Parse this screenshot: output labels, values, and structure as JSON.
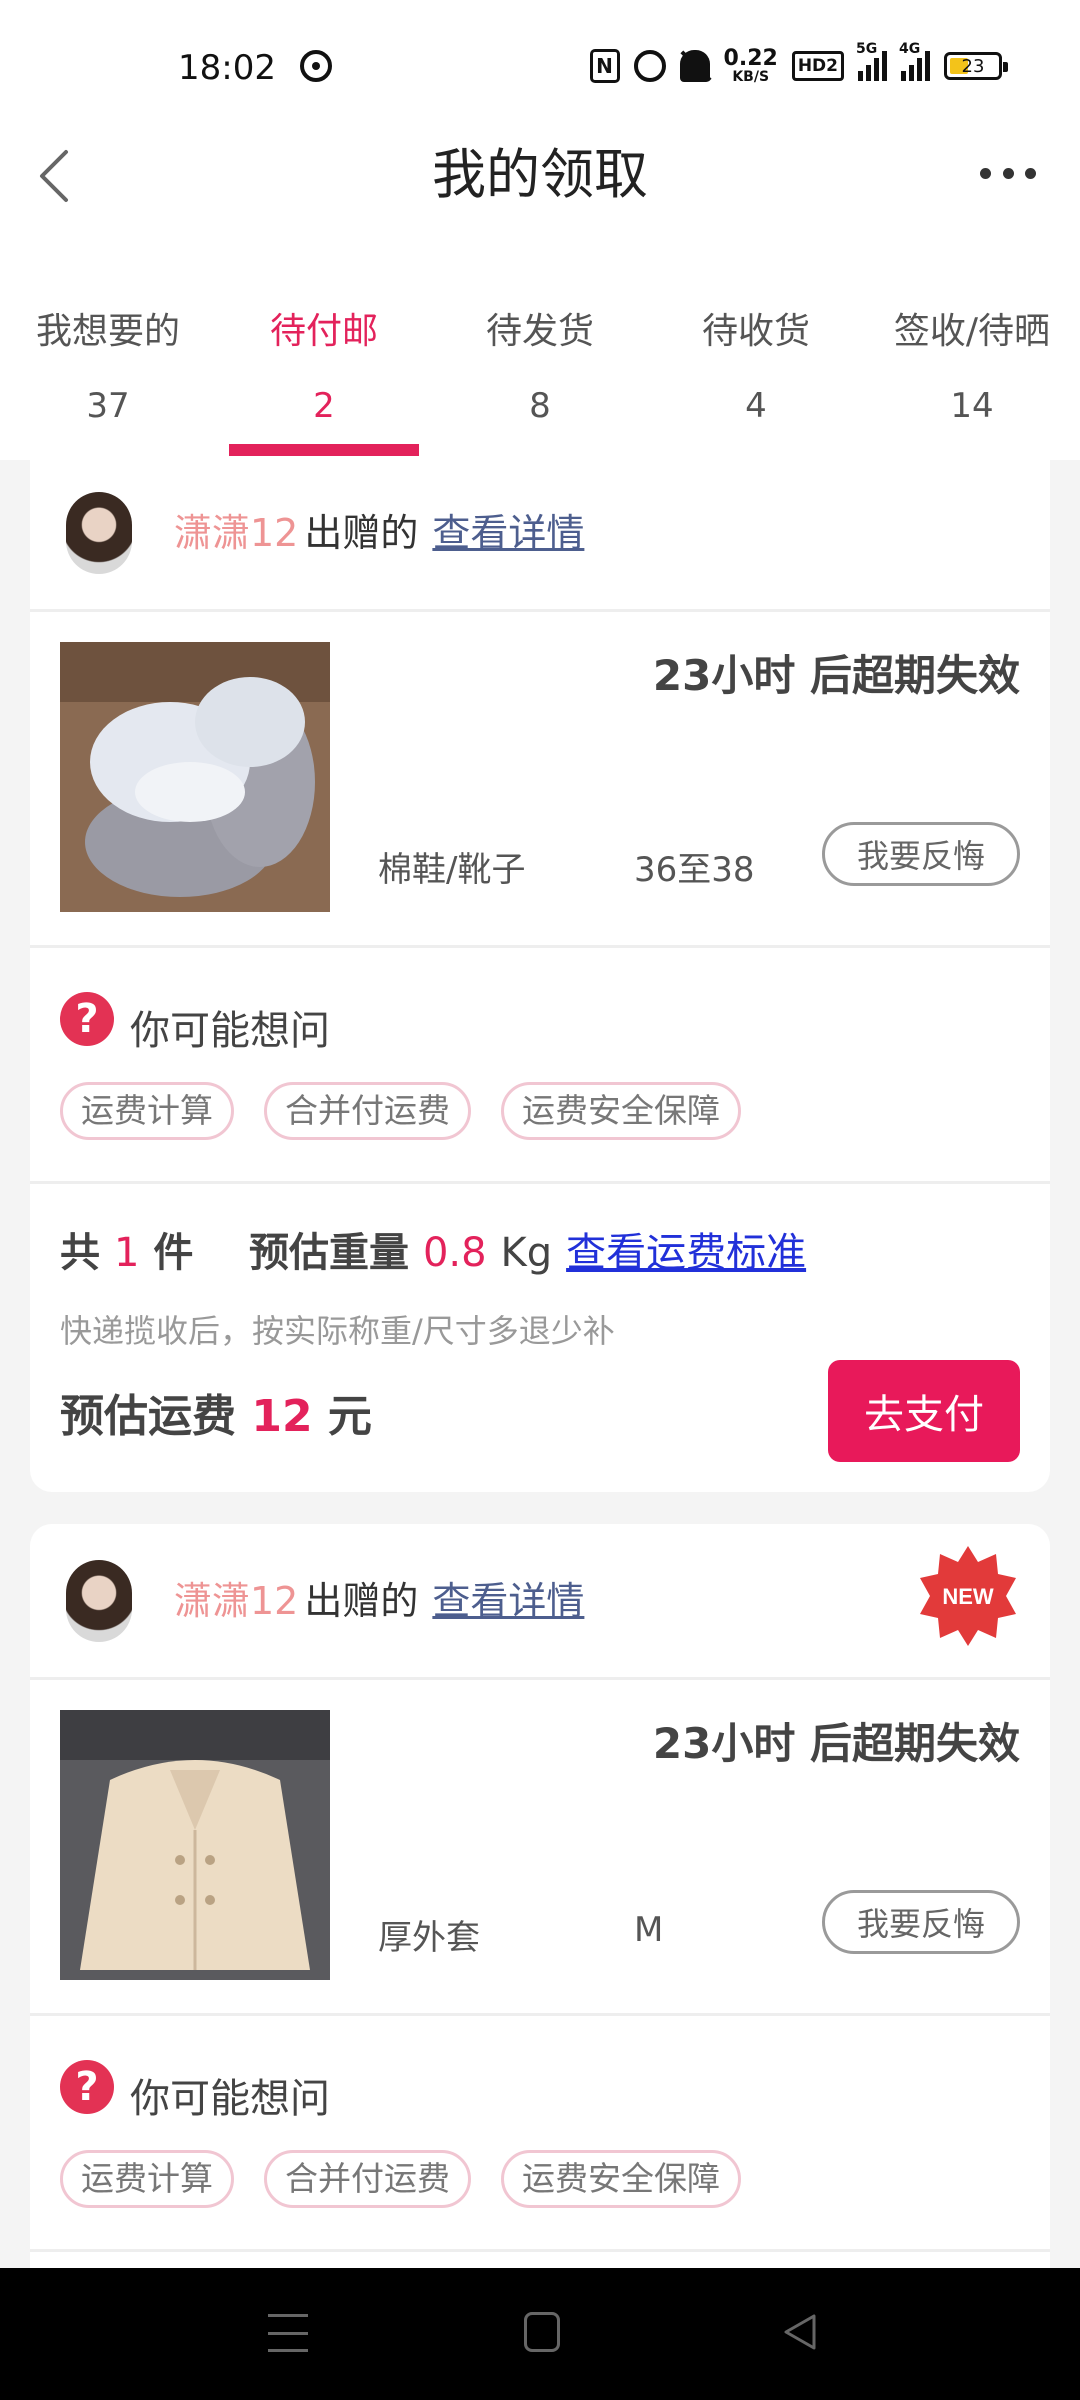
{
  "status_bar": {
    "time": "18:02",
    "nfc": "N",
    "speed_value": "0.22",
    "speed_unit": "KB/S",
    "hd": "HD2",
    "net1": "5G",
    "net2": "4G",
    "battery": "23"
  },
  "header": {
    "title": "我的领取"
  },
  "tabs": [
    {
      "label": "我想要的",
      "count": "37"
    },
    {
      "label": "待付邮",
      "count": "2"
    },
    {
      "label": "待发货",
      "count": "8"
    },
    {
      "label": "待收货",
      "count": "4"
    },
    {
      "label": "签收/待晒",
      "count": "14"
    }
  ],
  "accent_color": "#e3225b",
  "cards": [
    {
      "giver_name": "潇潇12",
      "giver_suffix": "出赠的",
      "detail_link": "查看详情",
      "expire_text": "23小时 后超期失效",
      "category": "棉鞋/靴子",
      "size": "36至38",
      "regret_label": "我要反悔",
      "faq_title": "你可能想问",
      "faq_chips": [
        "运费计算",
        "合并付运费",
        "运费安全保障"
      ],
      "summary": {
        "count_prefix": "共",
        "count": "1",
        "count_unit": "件",
        "weight_label": "预估重量",
        "weight": "0.8",
        "weight_unit": "Kg",
        "standard_link": "查看运费标准",
        "note": "快递揽收后，按实际称重/尺寸多退少补",
        "fee_label": "预估运费",
        "fee": "12",
        "fee_unit": "元",
        "pay_label": "去支付"
      }
    },
    {
      "giver_name": "潇潇12",
      "giver_suffix": "出赠的",
      "detail_link": "查看详情",
      "badge": "NEW",
      "expire_text": "23小时 后超期失效",
      "category": "厚外套",
      "size": "M",
      "regret_label": "我要反悔",
      "faq_title": "你可能想问",
      "faq_chips": [
        "运费计算",
        "合并付运费",
        "运费安全保障"
      ]
    }
  ]
}
